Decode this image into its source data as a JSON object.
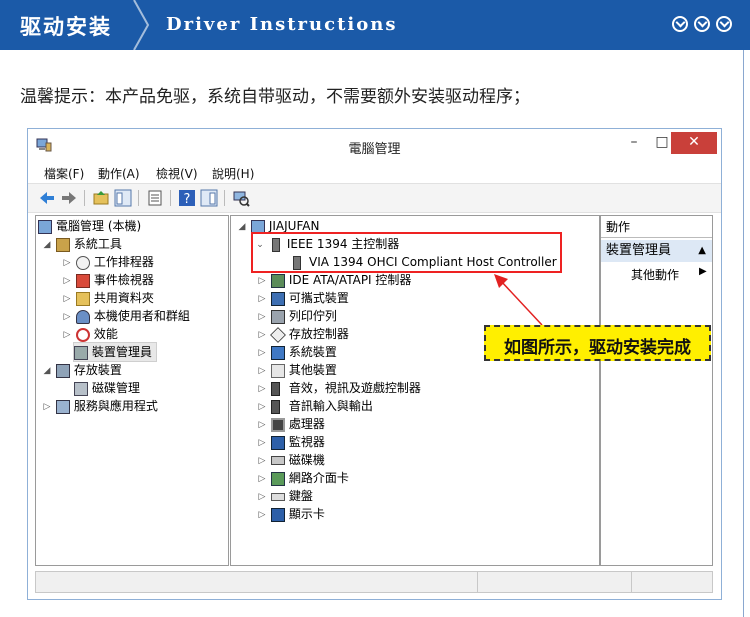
{
  "banner": {
    "title_cn": "驱动安装",
    "title_en": "Driver Instructions",
    "icons": [
      "chevron-down-circle-icon",
      "chevron-down-circle-icon",
      "chevron-down-circle-icon"
    ],
    "color": "#1b5aa8"
  },
  "tip": "温馨提示：本产品免驱，系统自带驱动，不需要额外安装驱动程序；",
  "window": {
    "title": "電腦管理",
    "controls": {
      "minimize": "–",
      "maximize": "□",
      "close": "✕"
    },
    "menu": [
      "檔案(F)",
      "動作(A)",
      "檢視(V)",
      "說明(H)"
    ],
    "left_tree": [
      "電腦管理 (本機)",
      "系統工具",
      "工作排程器",
      "事件檢視器",
      "共用資料夾",
      "本機使用者和群組",
      "效能",
      "裝置管理員",
      "存放裝置",
      "磁碟管理",
      "服務與應用程式"
    ],
    "device_tree": {
      "root": "JIAJUFAN",
      "expanded_category": "IEEE 1394 主控制器",
      "expanded_device": "VIA 1394 OHCI Compliant Host Controller",
      "categories": [
        "IDE ATA/ATAPI 控制器",
        "可攜式裝置",
        "列印佇列",
        "存放控制器",
        "系統裝置",
        "其他裝置",
        "音效，視訊及遊戲控制器",
        "音訊輸入與輸出",
        "處理器",
        "監視器",
        "磁碟機",
        "網路介面卡",
        "鍵盤",
        "顯示卡"
      ]
    },
    "actions": {
      "header": "動作",
      "section": "裝置管理員",
      "item": "其他動作"
    }
  },
  "callout": "如图所示，驱动安装完成",
  "colors": {
    "highlight": "#ffef00",
    "annotation": "#e22222",
    "close_button": "#c9403a"
  }
}
